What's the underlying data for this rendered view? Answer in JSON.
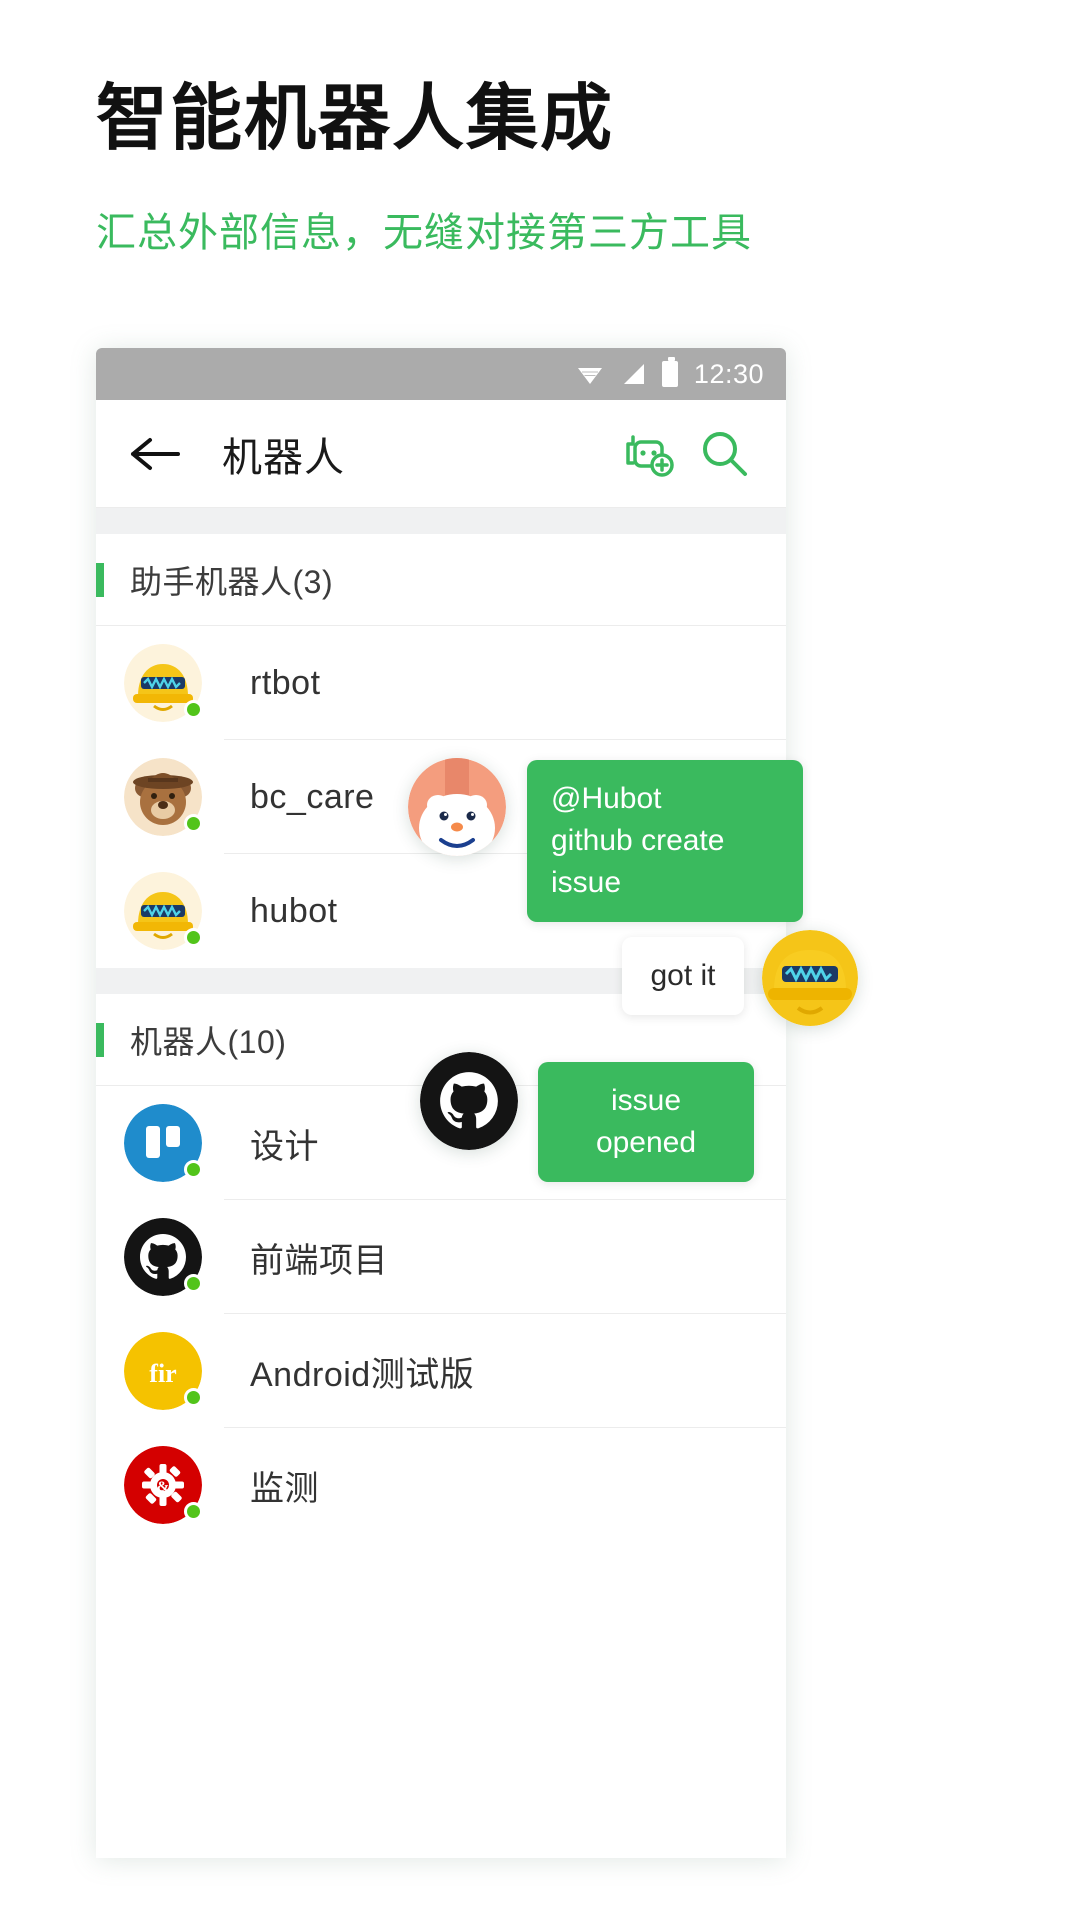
{
  "promo": {
    "title": "智能机器人集成",
    "subtitle": "汇总外部信息，无缝对接第三方工具"
  },
  "colors": {
    "accent_green": "#3aba5e",
    "status_bar": "#ababab",
    "online_dot": "#52c41a",
    "trello_blue": "#1f8ccc",
    "fir_yellow": "#f5c200",
    "zabbix_red": "#d40000"
  },
  "phone": {
    "statusbar": {
      "time": "12:30",
      "icons": [
        "wifi-icon",
        "signal-icon",
        "battery-icon"
      ]
    },
    "toolbar": {
      "back_icon": "back-arrow-icon",
      "title": "机器人",
      "actions": [
        {
          "icon": "add-robot-icon",
          "name": "add-robot-button"
        },
        {
          "icon": "search-icon",
          "name": "search-button"
        }
      ]
    },
    "sections": [
      {
        "label": "助手机器人(3)",
        "rows": [
          {
            "label": "rtbot",
            "avatar": "rtbot-hardhat-avatar",
            "online": true
          },
          {
            "label": "bc_care",
            "avatar": "bear-cowboy-avatar",
            "online": true
          },
          {
            "label": "hubot",
            "avatar": "hubot-hardhat-avatar",
            "online": true
          }
        ]
      },
      {
        "label": "机器人(10)",
        "rows": [
          {
            "label": "设计",
            "avatar": "trello-icon",
            "online": true
          },
          {
            "label": "前端项目",
            "avatar": "github-icon",
            "online": true
          },
          {
            "label": "Android测试版",
            "avatar": "fir-icon",
            "online": true
          },
          {
            "label": "监测",
            "avatar": "zabbix-icon",
            "online": true
          }
        ]
      }
    ]
  },
  "overlay": {
    "messages": [
      {
        "text": "@Hubot\ngithub create issue",
        "style": "green",
        "name": "chat-bubble-command"
      },
      {
        "text": "got it",
        "style": "white",
        "name": "chat-bubble-ack"
      },
      {
        "text": "issue opened",
        "style": "green",
        "name": "chat-bubble-result"
      }
    ],
    "avatars": [
      {
        "icon": "polar-bear-avatar",
        "name": "overlay-avatar-bear"
      },
      {
        "icon": "hubot-avatar",
        "name": "overlay-avatar-hubot"
      },
      {
        "icon": "github-avatar",
        "name": "overlay-avatar-github"
      }
    ]
  }
}
